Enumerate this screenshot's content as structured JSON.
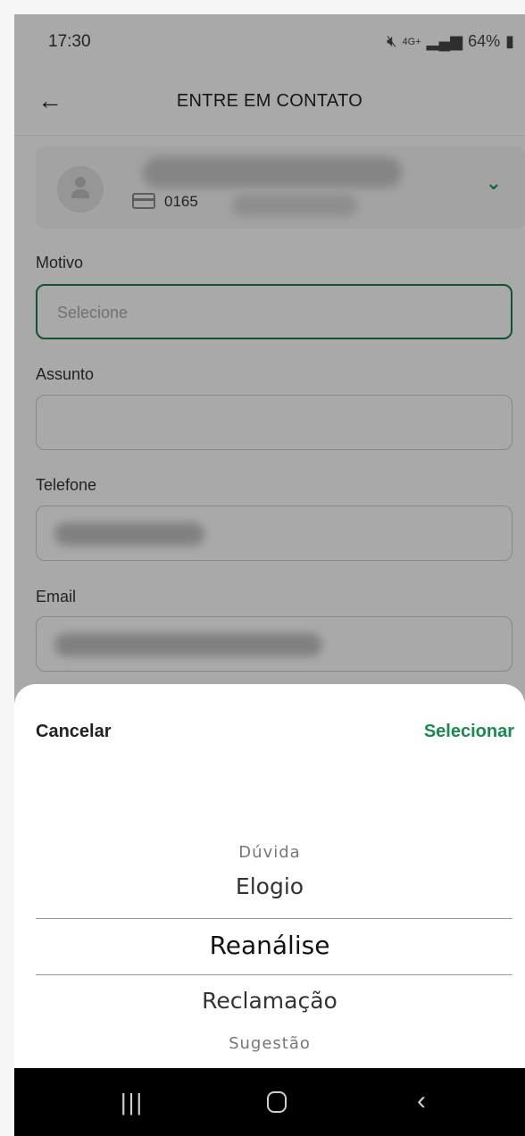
{
  "status_bar": {
    "time": "17:30",
    "network": "4G+",
    "battery": "64%",
    "icons": [
      "mute-icon",
      "signal-icon",
      "battery-icon"
    ]
  },
  "app_bar": {
    "title": "ENTRE EM CONTATO",
    "back_icon": "arrow-left-icon"
  },
  "account": {
    "number_prefix": "0165",
    "icons": [
      "avatar-icon",
      "card-icon",
      "chevron-down-icon"
    ]
  },
  "form": {
    "motivo": {
      "label": "Motivo",
      "placeholder": "Selecione"
    },
    "assunto": {
      "label": "Assunto",
      "value": ""
    },
    "telefone": {
      "label": "Telefone"
    },
    "email": {
      "label": "Email"
    }
  },
  "picker": {
    "cancel_label": "Cancelar",
    "select_label": "Selecionar",
    "options": [
      "Dúvida",
      "Elogio",
      "Reanálise",
      "Reclamação",
      "Sugestão"
    ],
    "selected": "Reanálise"
  },
  "colors": {
    "accent_green": "#1a8a4f",
    "active_border": "#1a7a4a",
    "navbar": "#000000"
  },
  "nav_bar": {
    "icons": [
      "recent-apps-icon",
      "home-icon",
      "back-icon"
    ]
  }
}
